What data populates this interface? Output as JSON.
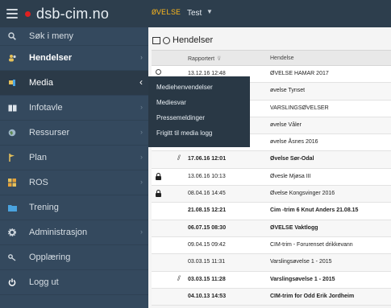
{
  "app": {
    "brand": "dsb-cim.no",
    "mode": "ØVELSE",
    "environment": "Test",
    "colors": {
      "topbar": "#2d3e4d",
      "sidebar": "#34495e",
      "brand_dot": "#e02020",
      "mode": "#f0b020"
    }
  },
  "sidebar": {
    "items": [
      {
        "label": "Søk i meny",
        "icon": "search-icon"
      },
      {
        "label": "Hendelser",
        "icon": "users-icon"
      },
      {
        "label": "Media",
        "icon": "megaphone-icon"
      },
      {
        "label": "Infotavle",
        "icon": "board-icon"
      },
      {
        "label": "Ressurser",
        "icon": "globe-icon"
      },
      {
        "label": "Plan",
        "icon": "flag-icon"
      },
      {
        "label": "ROS",
        "icon": "grid-icon"
      },
      {
        "label": "Trening",
        "icon": "folder-icon"
      },
      {
        "label": "Administrasjon",
        "icon": "gear-icon"
      },
      {
        "label": "Opplæring",
        "icon": "key-icon"
      },
      {
        "label": "Logg ut",
        "icon": "power-icon"
      }
    ]
  },
  "submenu": {
    "items": [
      "Mediehenvendelser",
      "Mediesvar",
      "Pressemeldinger",
      "Frigitt til media logg"
    ]
  },
  "panel": {
    "title": "Hendelser",
    "columns": {
      "reported": "Rapportert",
      "event": "Hendelse"
    },
    "rows": [
      {
        "date": "13.12.16 12:48",
        "title": "ØVELSE HAMAR 2017",
        "bold": true,
        "mark": "circle"
      },
      {
        "date": "",
        "title": "øvelse Tynset",
        "bold": true,
        "mark": ""
      },
      {
        "date": "",
        "title": "VARSLINGSØVELSER",
        "bold": true,
        "mark": ""
      },
      {
        "date": "",
        "title": "øvelse Våler",
        "bold": true,
        "mark": ""
      },
      {
        "date": "",
        "title": "øvelse Åsnes 2016",
        "bold": true,
        "mark": ""
      },
      {
        "date": "17.06.16 12:01",
        "title": "Øvelse Sør-Odal",
        "bold": true,
        "mark": "clip"
      },
      {
        "date": "13.06.16 10:13",
        "title": "Øvesle Mjøsa III",
        "bold": true,
        "mark": "lock"
      },
      {
        "date": "08.04.16 14:45",
        "title": "Øvelse Kongsvinger 2016",
        "bold": true,
        "mark": "lock"
      },
      {
        "date": "21.08.15 12:21",
        "title": "Cim -trim 6 Knut Anders 21.08.15",
        "bold": true,
        "mark": ""
      },
      {
        "date": "06.07.15 08:30",
        "title": "ØVELSE Vaktlogg",
        "bold": true,
        "mark": ""
      },
      {
        "date": "09.04.15 09:42",
        "title": "CIM-trim - Forurenset drikkevann",
        "bold": false,
        "mark": ""
      },
      {
        "date": "03.03.15 11:31",
        "title": "Varslingsøvelse 1 - 2015",
        "bold": false,
        "mark": ""
      },
      {
        "date": "03.03.15 11:28",
        "title": "Varslingsøvelse 1 - 2015",
        "bold": true,
        "mark": "clip"
      },
      {
        "date": "04.10.13 14:53",
        "title": "CIM-trim for Odd Erik Jordheim",
        "bold": true,
        "mark": ""
      }
    ]
  }
}
